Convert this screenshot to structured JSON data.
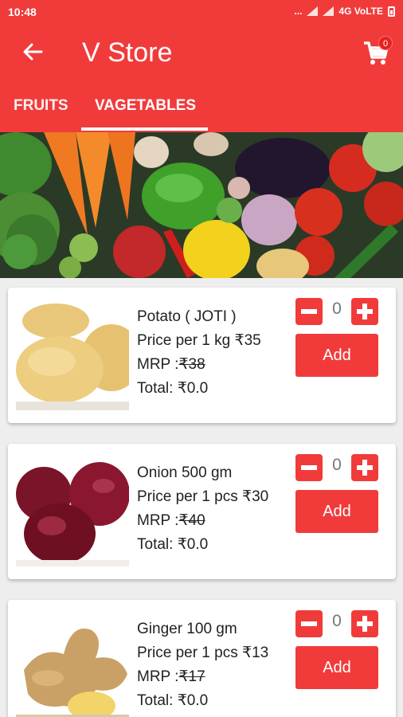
{
  "status_bar": {
    "time": "10:48",
    "dots": "...",
    "network": "4G VoLTE"
  },
  "app_bar": {
    "title": "V Store",
    "cart_count": "0"
  },
  "tabs": [
    {
      "label": "FRUITS",
      "selected": false
    },
    {
      "label": "VAGETABLES",
      "selected": true
    }
  ],
  "products": [
    {
      "name": "Potato ( JOTI )",
      "price": "Price per 1 kg  ₹35",
      "mrp_label": "MRP :",
      "mrp_value": "₹38",
      "total": "Total: ₹0.0",
      "quantity": "0",
      "add_label": "Add"
    },
    {
      "name": "Onion 500 gm",
      "price": "Price per 1 pcs  ₹30",
      "mrp_label": "MRP :",
      "mrp_value": "₹40",
      "total": "Total: ₹0.0",
      "quantity": "0",
      "add_label": "Add"
    },
    {
      "name": "Ginger 100 gm",
      "price": "Price per 1 pcs  ₹13",
      "mrp_label": "MRP :",
      "mrp_value": "₹17",
      "total": "Total: ₹0.0",
      "quantity": "0",
      "add_label": "Add"
    }
  ],
  "colors": {
    "primary": "#f13b3b",
    "background": "#eeeeee",
    "card": "#ffffff"
  }
}
